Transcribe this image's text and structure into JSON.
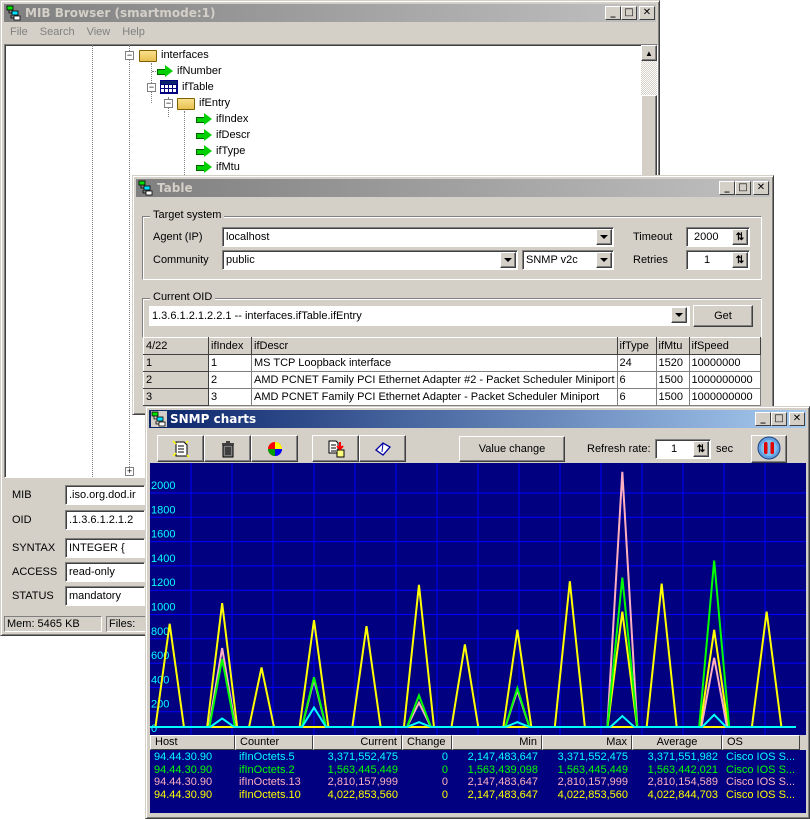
{
  "mib_browser": {
    "title": "MIB Browser (smartmode:1)",
    "menu": [
      "File",
      "Search",
      "View",
      "Help"
    ],
    "tree": [
      {
        "label": "interfaces",
        "icon": "folder-open-icon",
        "expanded": true
      },
      {
        "label": "ifNumber",
        "icon": "green-arrow-icon"
      },
      {
        "label": "ifTable",
        "icon": "table-icon",
        "expanded": true
      },
      {
        "label": "ifEntry",
        "icon": "folder-open-icon",
        "expanded": true
      },
      {
        "label": "ifIndex",
        "icon": "green-arrow-icon"
      },
      {
        "label": "ifDescr",
        "icon": "green-arrow-icon"
      },
      {
        "label": "ifType",
        "icon": "green-arrow-icon"
      },
      {
        "label": "ifMtu",
        "icon": "green-arrow-icon"
      }
    ],
    "props": [
      {
        "label": "MIB",
        "value": ".iso.org.dod.ir"
      },
      {
        "label": "OID",
        "value": ".1.3.6.1.2.1.2"
      },
      {
        "label": "SYNTAX",
        "value": "INTEGER {"
      },
      {
        "label": "ACCESS",
        "value": "read-only"
      },
      {
        "label": "STATUS",
        "value": "mandatory"
      }
    ],
    "status": {
      "mem": "Mem: 5465 KB",
      "files": "Files:"
    }
  },
  "table_window": {
    "title": "Table",
    "target_group": "Target system",
    "agent_label": "Agent (IP)",
    "agent_value": "localhost",
    "community_label": "Community",
    "community_value": "public",
    "snmp_version": "SNMP v2c",
    "timeout_label": "Timeout",
    "timeout_value": "2000",
    "retries_label": "Retries",
    "retries_value": "1",
    "oid_group": "Current OID",
    "oid_value": "1.3.6.1.2.1.2.2.1  -- interfaces.ifTable.ifEntry",
    "get_label": "Get",
    "columns": [
      "4/22",
      "ifIndex",
      "ifDescr",
      "ifType",
      "ifMtu",
      "ifSpeed"
    ],
    "rows": [
      [
        "1",
        "1",
        "MS TCP Loopback interface",
        "24",
        "1520",
        "10000000"
      ],
      [
        "2",
        "2",
        "AMD PCNET Family PCI Ethernet Adapter #2 - Packet Scheduler Miniport",
        "6",
        "1500",
        "1000000000"
      ],
      [
        "3",
        "3",
        "AMD PCNET Family PCI Ethernet Adapter - Packet Scheduler Miniport",
        "6",
        "1500",
        "1000000000"
      ]
    ]
  },
  "charts_window": {
    "title": "SNMP charts",
    "toolbar_icons": [
      "new-chart-icon",
      "trash-icon",
      "pie-chart-icon",
      "export-icon",
      "book-icon"
    ],
    "value_change_label": "Value change",
    "refresh_label": "Refresh rate:",
    "refresh_value": "1",
    "refresh_unit": "sec",
    "table_columns": [
      "Host",
      "Counter",
      "Current",
      "Change",
      "Min",
      "Max",
      "Average",
      "OS"
    ],
    "table_rows": [
      {
        "color": "#00ffff",
        "cells": [
          "94.44.30.90",
          "ifInOctets.5",
          "3,371,552,475",
          "0",
          "2,147,483,647",
          "3,371,552,475",
          "3,371,551,982",
          "Cisco IOS S..."
        ]
      },
      {
        "color": "#00ff00",
        "cells": [
          "94.44.30.90",
          "ifInOctets.2",
          "1,563,445,449",
          "0",
          "1,563,439,098",
          "1,563,445,449",
          "1,563,442,021",
          "Cisco IOS S..."
        ]
      },
      {
        "color": "#ffb0c0",
        "cells": [
          "94.44.30.90",
          "ifInOctets.13",
          "2,810,157,999",
          "0",
          "2,147,483,647",
          "2,810,157,999",
          "2,810,154,589",
          "Cisco IOS S..."
        ]
      },
      {
        "color": "#ffff00",
        "cells": [
          "94.44.30.90",
          "ifInOctets.10",
          "4,022,853,560",
          "0",
          "2,147,483,647",
          "4,022,853,560",
          "4,022,844,703",
          "Cisco IOS S..."
        ]
      }
    ]
  },
  "chart_data": {
    "type": "line",
    "title": "SNMP charts",
    "xlabel": "",
    "ylabel": "",
    "ylim": [
      0,
      2200
    ],
    "yticks": [
      0,
      200,
      400,
      600,
      800,
      1000,
      1200,
      1400,
      1600,
      1800,
      2000
    ],
    "grid": true,
    "background": "#000080",
    "peak_positions": [
      0.03,
      0.11,
      0.17,
      0.25,
      0.33,
      0.41,
      0.48,
      0.56,
      0.64,
      0.72,
      0.78,
      0.86,
      0.94
    ],
    "series": [
      {
        "name": "ifInOctets.10",
        "color": "#ffff00",
        "values": [
          850,
          1020,
          490,
          880,
          830,
          1170,
          680,
          800,
          1200,
          950,
          1180,
          800,
          950
        ]
      },
      {
        "name": "ifInOctets.13",
        "color": "#ffb0c0",
        "values": [
          0,
          650,
          0,
          390,
          0,
          200,
          0,
          300,
          0,
          2100,
          0,
          570,
          0
        ]
      },
      {
        "name": "ifInOctets.2",
        "color": "#00ff00",
        "values": [
          0,
          560,
          0,
          410,
          0,
          260,
          0,
          320,
          0,
          1230,
          0,
          1370,
          0
        ]
      },
      {
        "name": "ifInOctets.5",
        "color": "#00ffff",
        "values": [
          0,
          70,
          0,
          160,
          0,
          40,
          0,
          40,
          0,
          90,
          0,
          100,
          0
        ]
      }
    ]
  }
}
